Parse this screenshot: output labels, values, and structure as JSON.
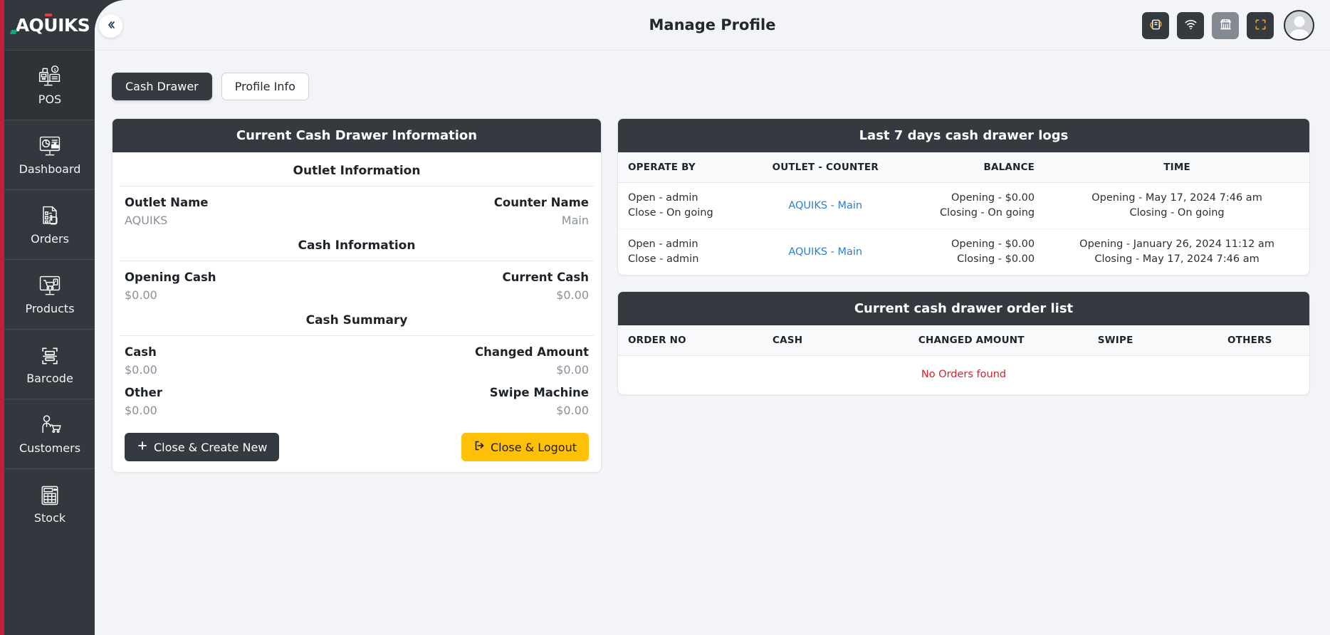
{
  "brand": {
    "logo_text": "AQUIKS",
    "accent_red": "#c41e3f",
    "accent_green": "#0fa37f"
  },
  "header": {
    "title": "Manage Profile",
    "collapse_icon": "chevron-double-left-icon",
    "actions": [
      {
        "name": "sync-icon",
        "label": "sync"
      },
      {
        "name": "wifi-icon",
        "label": "wifi"
      },
      {
        "name": "store-icon",
        "label": "store"
      },
      {
        "name": "fullscreen-icon",
        "label": "fullscreen"
      }
    ],
    "avatar": "user-avatar"
  },
  "sidebar": {
    "items": [
      {
        "label": "POS",
        "icon": "pos-terminal-icon",
        "active": true
      },
      {
        "label": "Dashboard",
        "icon": "dashboard-chart-icon",
        "active": false
      },
      {
        "label": "Orders",
        "icon": "orders-clipboard-icon",
        "active": false
      },
      {
        "label": "Products",
        "icon": "products-cart-icon",
        "active": false
      },
      {
        "label": "Barcode",
        "icon": "barcode-scan-icon",
        "active": false
      },
      {
        "label": "Customers",
        "icon": "customer-cart-icon",
        "active": false
      },
      {
        "label": "Stock",
        "icon": "stock-calculator-icon",
        "active": false
      }
    ]
  },
  "tabs": [
    {
      "label": "Cash Drawer",
      "active": true
    },
    {
      "label": "Profile Info",
      "active": false
    }
  ],
  "drawer_card": {
    "title": "Current Cash Drawer Information",
    "outlet_section": "Outlet Information",
    "outlet_name_label": "Outlet Name",
    "counter_name_label": "Counter Name",
    "outlet_name_value": "AQUIKS",
    "counter_name_value": "Main",
    "cash_section": "Cash Information",
    "opening_cash_label": "Opening Cash",
    "current_cash_label": "Current Cash",
    "opening_cash_value": "$0.00",
    "current_cash_value": "$0.00",
    "summary_section": "Cash Summary",
    "cash_label": "Cash",
    "changed_amount_label": "Changed Amount",
    "cash_value": "$0.00",
    "changed_amount_value": "$0.00",
    "other_label": "Other",
    "swipe_machine_label": "Swipe Machine",
    "other_value": "$0.00",
    "swipe_machine_value": "$0.00",
    "close_create_button": "Close & Create New",
    "close_logout_button": "Close & Logout",
    "close_create_icon": "plus-icon",
    "close_logout_icon": "logout-arrow-icon"
  },
  "logs_card": {
    "title": "Last 7 days cash drawer logs",
    "columns": [
      "OPERATE BY",
      "OUTLET - COUNTER",
      "BALANCE",
      "TIME"
    ],
    "rows": [
      {
        "operate_by": [
          "Open - admin",
          "Close - On going"
        ],
        "outlet_counter": "AQUIKS - Main",
        "balance": [
          "Opening - $0.00",
          "Closing - On going"
        ],
        "time": [
          "Opening - May 17, 2024 7:46 am",
          "Closing - On going"
        ]
      },
      {
        "operate_by": [
          "Open - admin",
          "Close - admin"
        ],
        "outlet_counter": "AQUIKS - Main",
        "balance": [
          "Opening - $0.00",
          "Closing - $0.00"
        ],
        "time": [
          "Opening - January 26, 2024 11:12 am",
          "Closing - May 17, 2024 7:46 am"
        ]
      }
    ]
  },
  "order_card": {
    "title": "Current cash drawer order list",
    "columns": [
      "ORDER NO",
      "CASH",
      "CHANGED AMOUNT",
      "SWIPE",
      "OTHERS"
    ],
    "empty_message": "No Orders found"
  }
}
